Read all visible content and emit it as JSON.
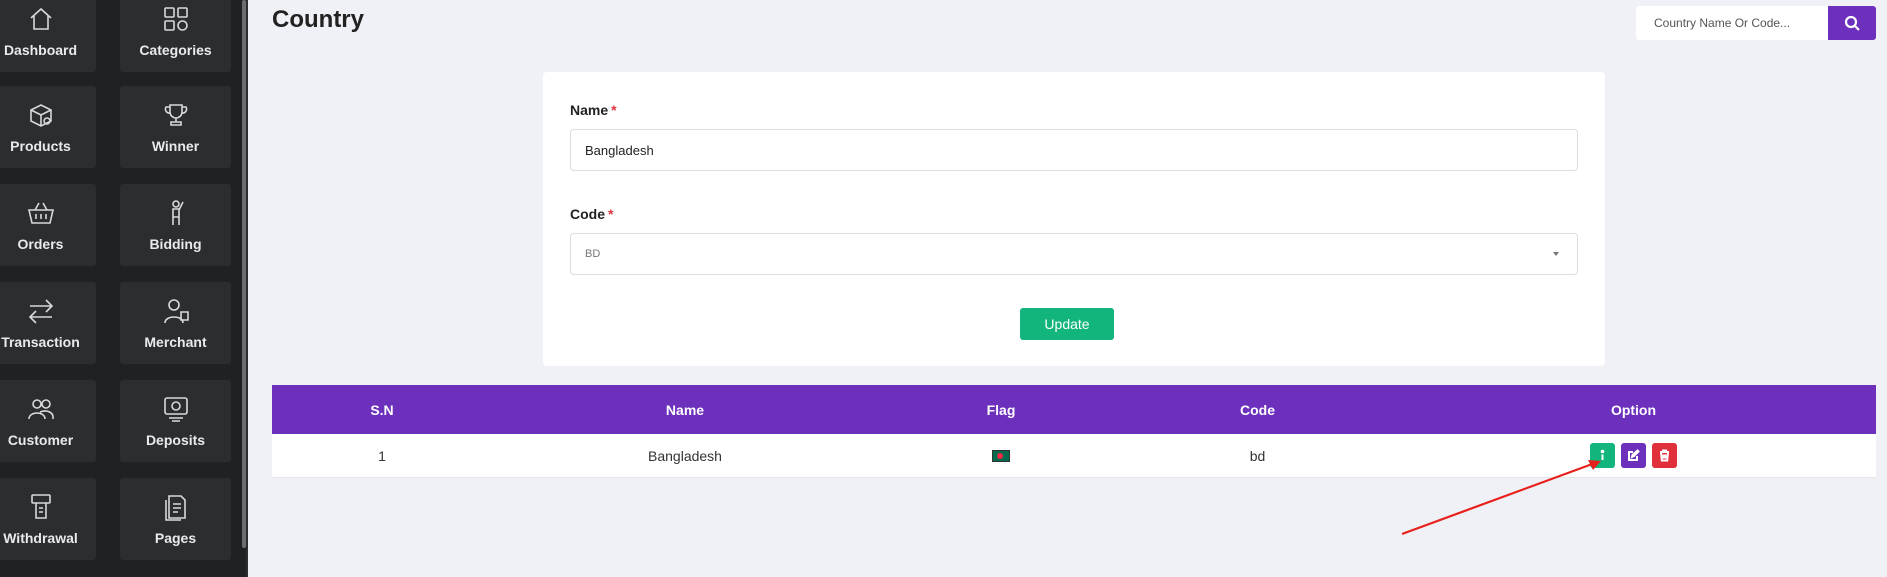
{
  "sidebar": {
    "items": [
      {
        "label": "Dashboard",
        "icon": "home-icon"
      },
      {
        "label": "Categories",
        "icon": "grid-icon"
      },
      {
        "label": "Products",
        "icon": "box-icon"
      },
      {
        "label": "Winner",
        "icon": "trophy-icon"
      },
      {
        "label": "Orders",
        "icon": "basket-icon"
      },
      {
        "label": "Bidding",
        "icon": "hand-raise-icon"
      },
      {
        "label": "Transaction",
        "icon": "arrows-exchange-icon"
      },
      {
        "label": "Merchant",
        "icon": "merchant-icon"
      },
      {
        "label": "Customer",
        "icon": "users-icon"
      },
      {
        "label": "Deposits",
        "icon": "deposit-icon"
      },
      {
        "label": "Withdrawal",
        "icon": "atm-icon"
      },
      {
        "label": "Pages",
        "icon": "pages-icon"
      }
    ]
  },
  "header": {
    "title": "Country",
    "search_placeholder": "Country Name Or Code..."
  },
  "form": {
    "name_label": "Name",
    "name_value": "Bangladesh",
    "code_label": "Code",
    "code_value": "BD",
    "required_mark": "*",
    "update_label": "Update"
  },
  "table": {
    "headers": [
      "S.N",
      "Name",
      "Flag",
      "Code",
      "Option"
    ],
    "rows": [
      {
        "sn": "1",
        "name": "Bangladesh",
        "code": "bd"
      }
    ]
  },
  "colors": {
    "accent": "#6c30bd",
    "success": "#12b57c",
    "danger": "#e0303b",
    "sidebar_bg": "#1f2123"
  }
}
